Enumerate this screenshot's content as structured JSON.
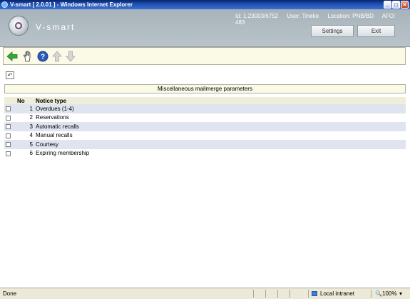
{
  "window": {
    "title": "V-smart [ 2.0.01 ] - Windows Internet Explorer",
    "controls": [
      "minimize",
      "maximize",
      "close"
    ]
  },
  "header": {
    "brand": "V-smart",
    "id_label": "Id: 1.23003/6752",
    "user_label": "User: Tineke",
    "location_label": "Location: PNB/BD",
    "afo_label": "AFO: 483",
    "settings_label": "Settings",
    "exit_label": "Exit"
  },
  "toolbar": {
    "icons": [
      "back-arrow-icon",
      "hand-select-icon",
      "help-icon",
      "up-arrow-icon",
      "down-arrow-icon"
    ]
  },
  "panel": {
    "title": "Miscellaneous mailmerge parameters"
  },
  "table": {
    "columns": [
      "",
      "No",
      "Notice type"
    ],
    "rows": [
      {
        "no": "1",
        "type": "Overdues (1-4)"
      },
      {
        "no": "2",
        "type": "Reservations"
      },
      {
        "no": "3",
        "type": "Automatic recalls"
      },
      {
        "no": "4",
        "type": "Manual recalls"
      },
      {
        "no": "5",
        "type": "Courtesy"
      },
      {
        "no": "6",
        "type": "Expiring membership"
      }
    ]
  },
  "statusbar": {
    "status": "Done",
    "zone": "Local intranet",
    "zoom": "100%"
  },
  "colors": {
    "header_bg": "#b0bcc2",
    "toolbar_bg": "#fafae6",
    "row_alt": "#dfe4ef",
    "titlebar": "#0a246a"
  }
}
